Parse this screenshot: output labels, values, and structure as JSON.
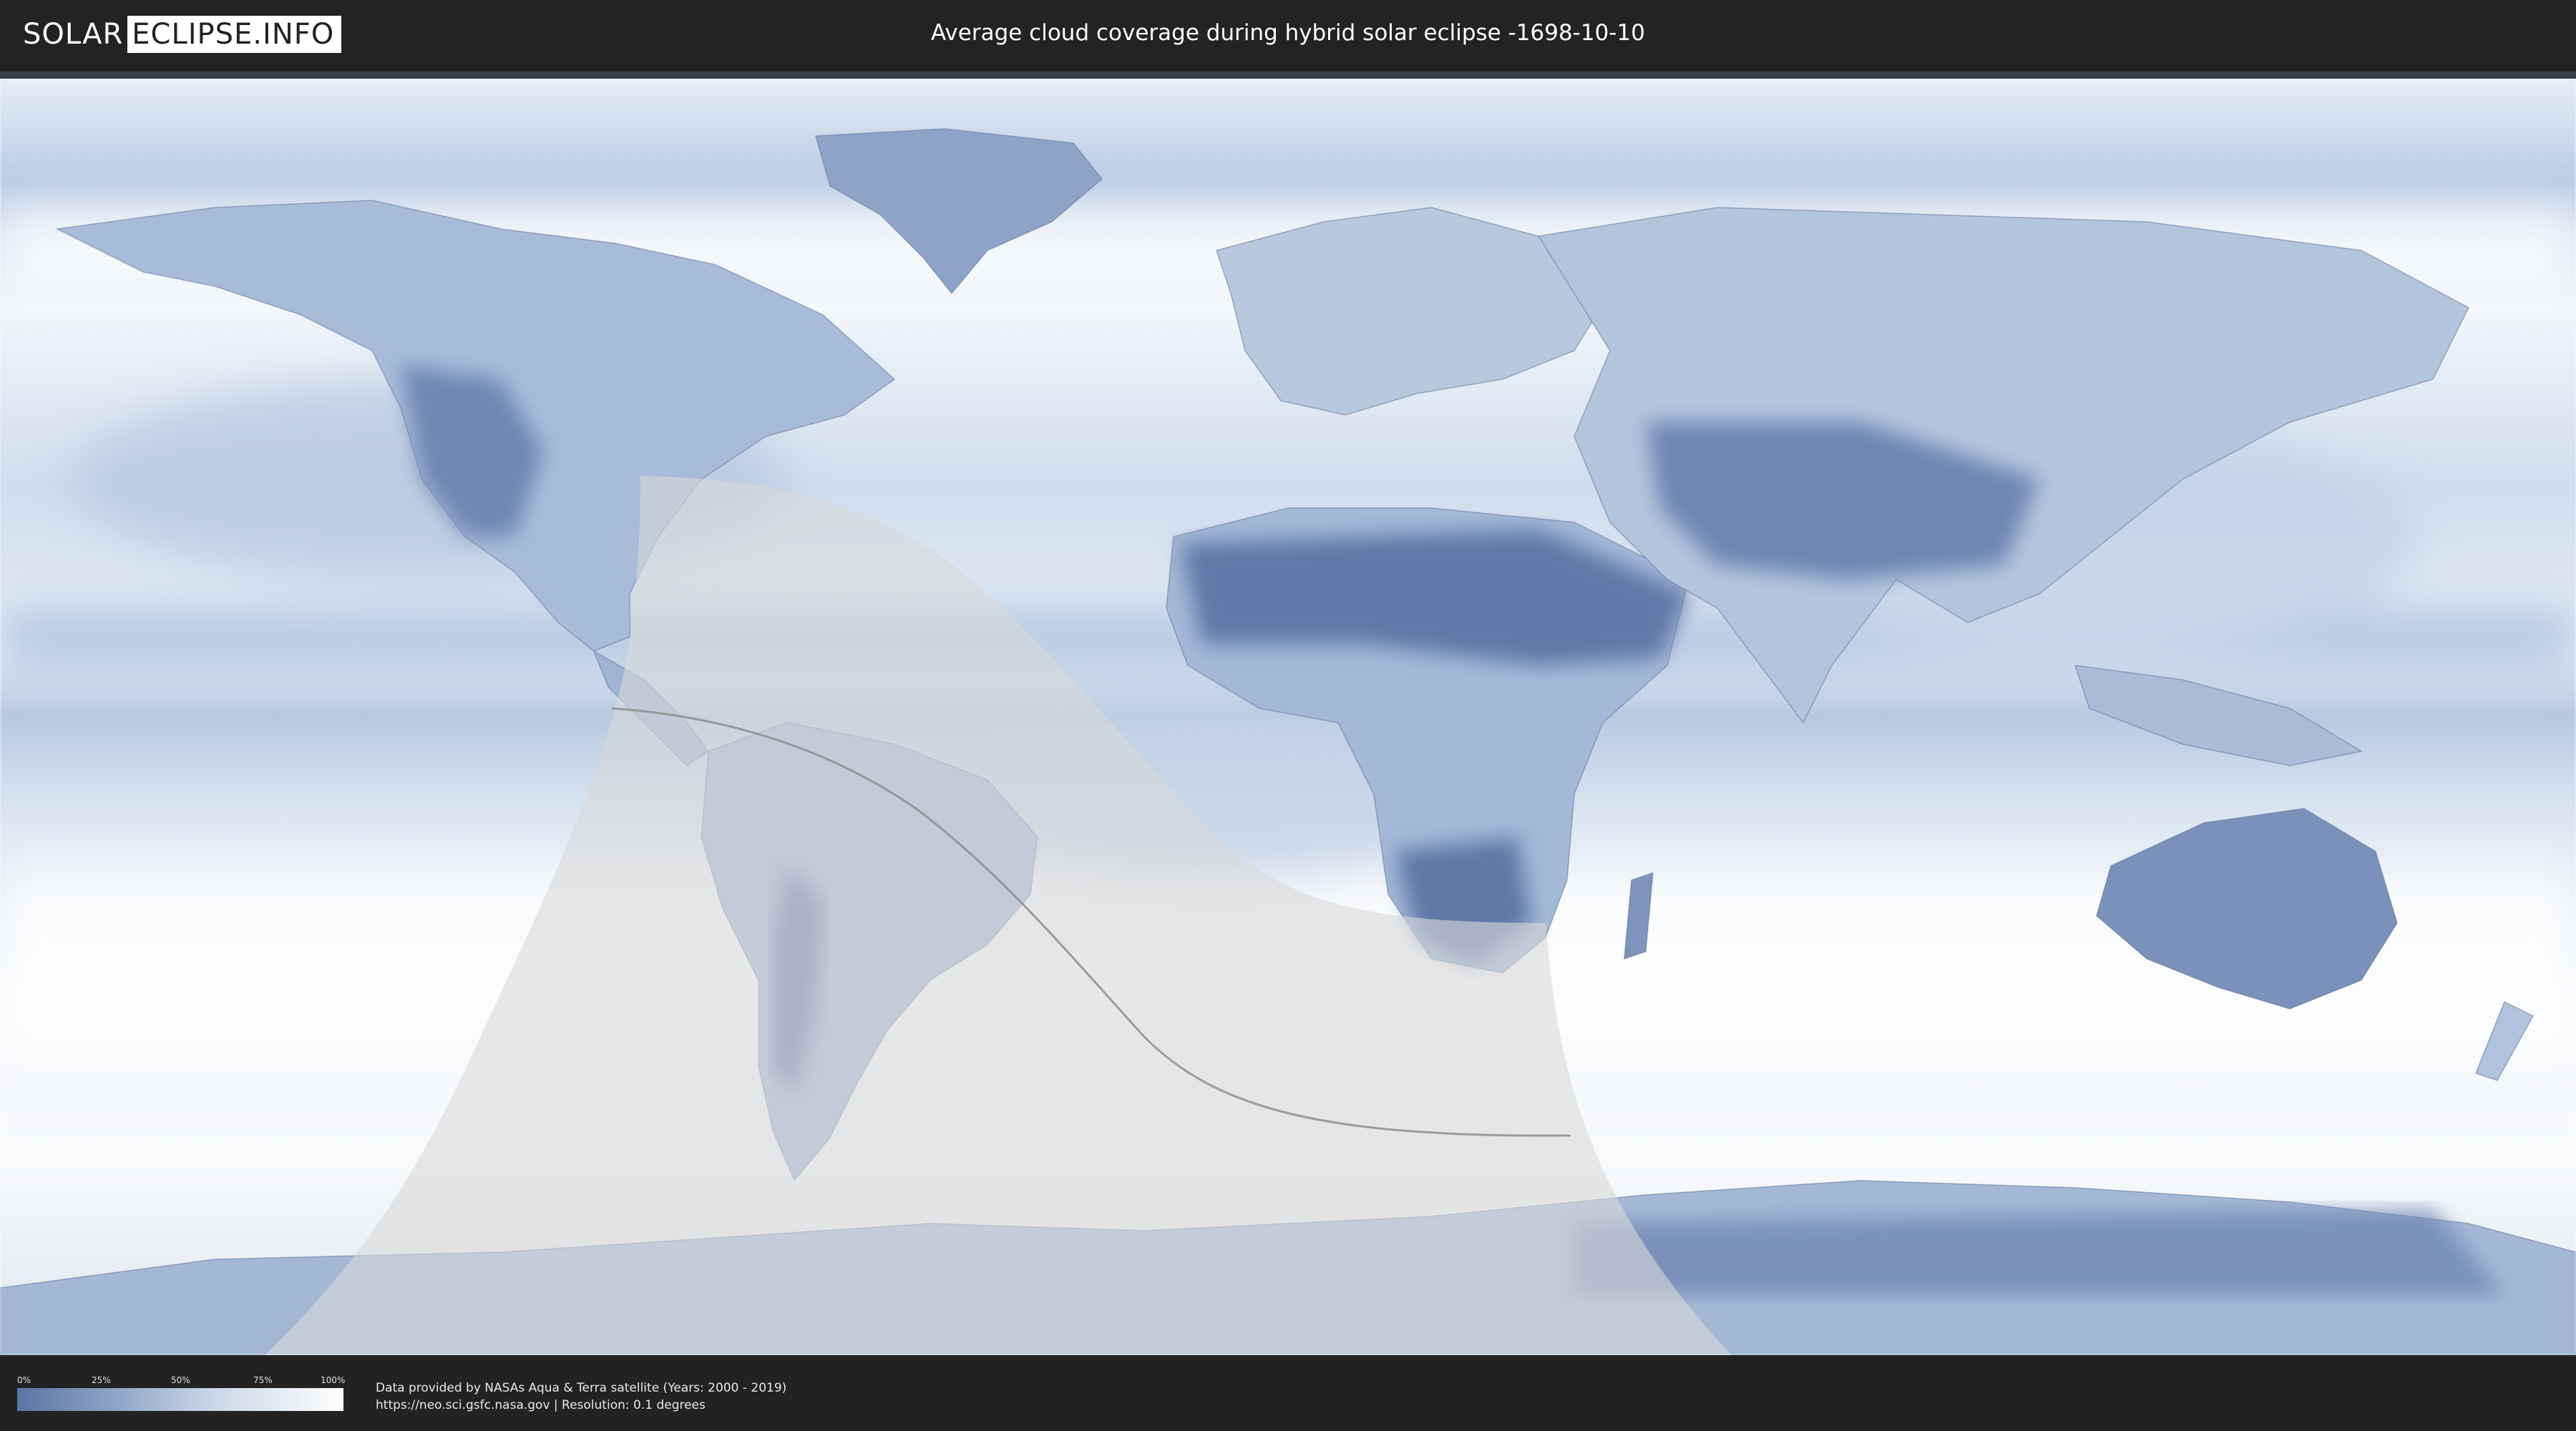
{
  "header": {
    "logo_left": "SOLAR",
    "logo_right": "ECLIPSE.INFO",
    "title": "Average cloud coverage during hybrid solar eclipse -1698-10-10"
  },
  "legend": {
    "ticks": [
      "0%",
      "25%",
      "50%",
      "75%",
      "100%"
    ],
    "color_low": "#5c74a3",
    "color_high": "#ffffff"
  },
  "footer": {
    "credit_line1": "Data provided by NASAs Aqua & Terra satellite (Years: 2000 - 2019)",
    "credit_line2": "https://neo.sci.gsfc.nasa.gov | Resolution: 0.1 degrees"
  },
  "colors": {
    "background": "#222222",
    "ocean_cloud": "#c9d7e8",
    "land_cloud": "#6f87b3",
    "eclipse_zone": "#d8d8d8"
  }
}
